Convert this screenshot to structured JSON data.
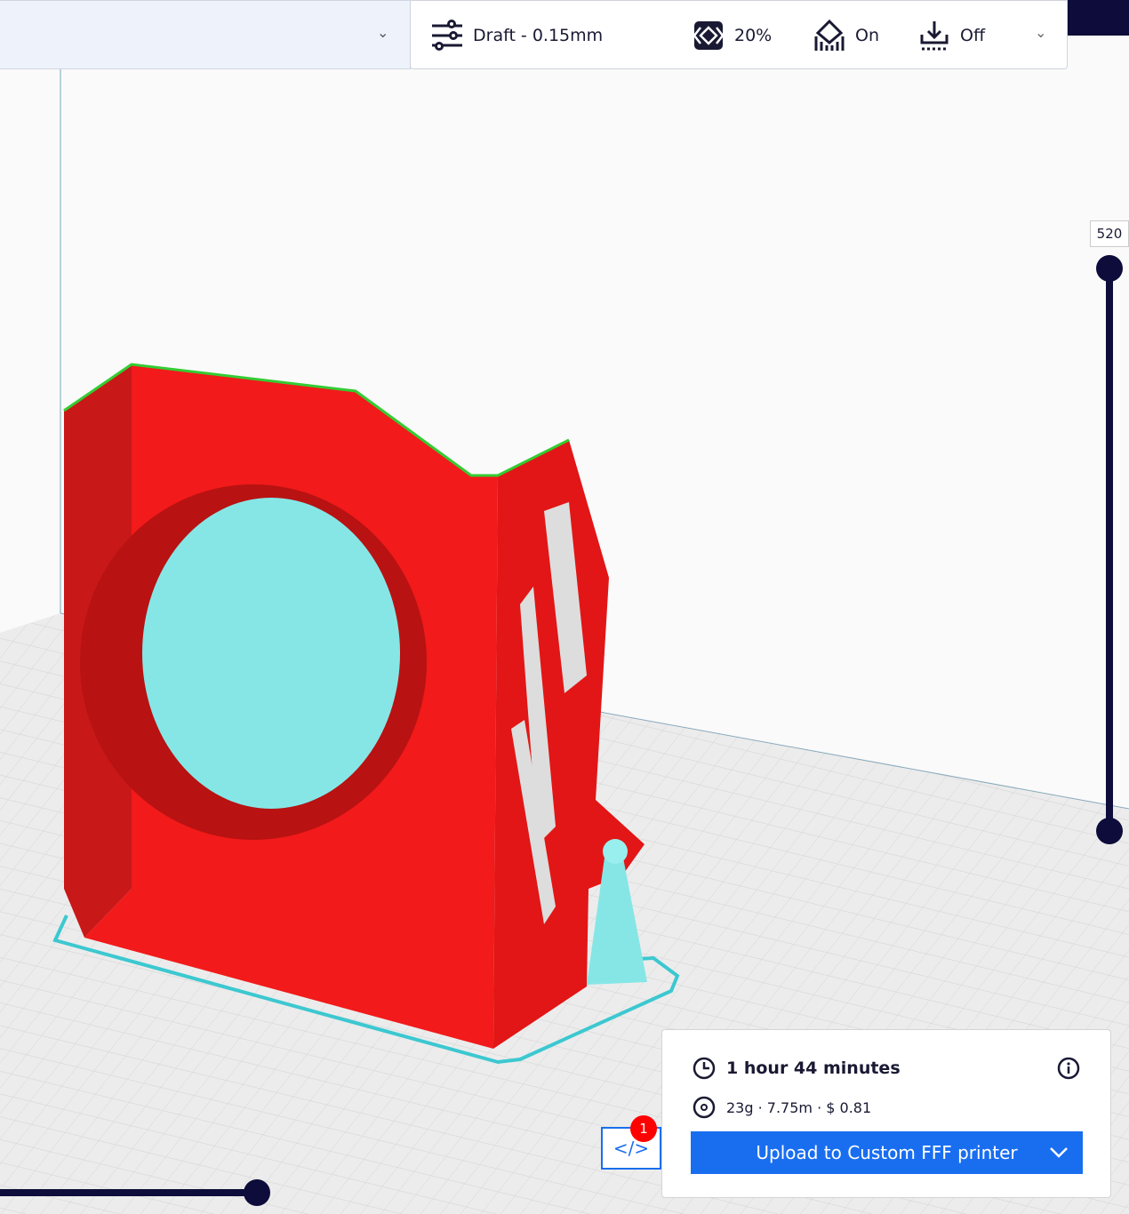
{
  "toolbar": {
    "profile": "Draft - 0.15mm",
    "infill": "20%",
    "support": "On",
    "adhesion": "Off"
  },
  "layer_slider": {
    "current_layer": "520"
  },
  "print_info": {
    "time": "1 hour 44 minutes",
    "material": "23g · 7.75m · $ 0.81",
    "upload_label": "Upload to Custom FFF printer"
  },
  "gcode_badge": "1",
  "colors": {
    "accent": "#196ef0",
    "navy": "#0d0c3a",
    "model": "#ff1a1a",
    "support": "#7fe8e8"
  }
}
